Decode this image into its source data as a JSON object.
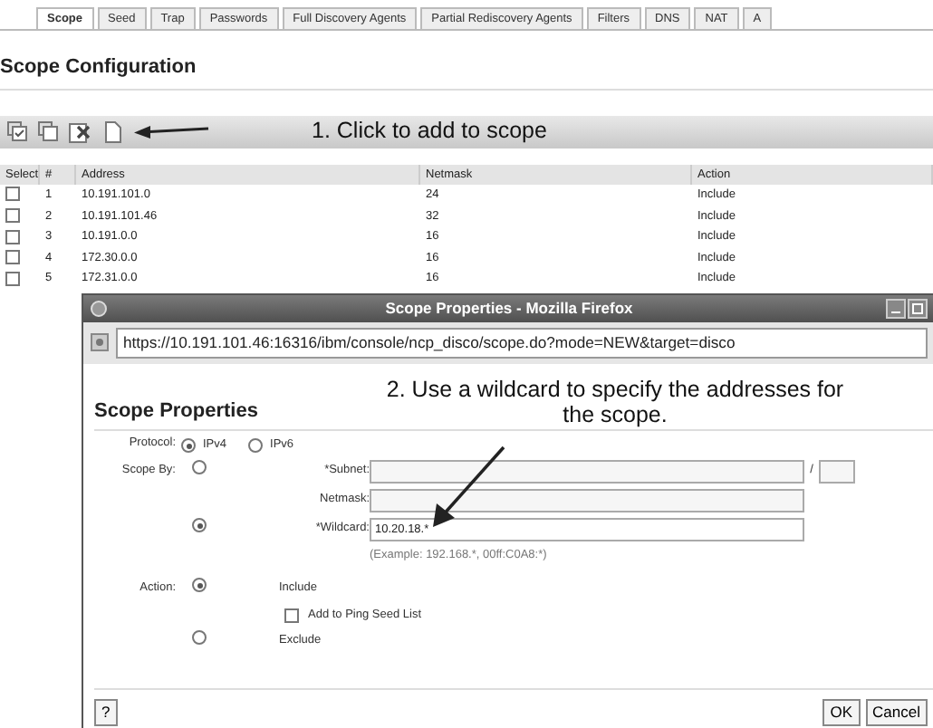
{
  "tabs": [
    {
      "label": "Scope",
      "selected": true
    },
    {
      "label": "Seed",
      "selected": false
    },
    {
      "label": "Trap",
      "selected": false
    },
    {
      "label": "Passwords",
      "selected": false
    },
    {
      "label": "Full Discovery Agents",
      "selected": false
    },
    {
      "label": "Partial Rediscovery Agents",
      "selected": false
    },
    {
      "label": "Filters",
      "selected": false
    },
    {
      "label": "DNS",
      "selected": false
    },
    {
      "label": "NAT",
      "selected": false
    },
    {
      "label": "A",
      "selected": false
    }
  ],
  "heading": "Scope Configuration",
  "toolbar": {
    "annotation": "1. Click to add to scope"
  },
  "table": {
    "columns": [
      "Select",
      "#",
      "Address",
      "Netmask",
      "Action"
    ],
    "rows": [
      {
        "checked": false,
        "number": "1",
        "address": "10.191.101.0",
        "netmask": "24",
        "action": "Include"
      },
      {
        "checked": false,
        "number": "2",
        "address": "10.191.101.46",
        "netmask": "32",
        "action": "Include"
      },
      {
        "checked": false,
        "number": "3",
        "address": "10.191.0.0",
        "netmask": "16",
        "action": "Include"
      },
      {
        "checked": false,
        "number": "4",
        "address": "172.30.0.0",
        "netmask": "16",
        "action": "Include"
      },
      {
        "checked": false,
        "number": "5",
        "address": "172.31.0.0",
        "netmask": "16",
        "action": "Include"
      }
    ]
  },
  "dialog": {
    "title": "Scope Properties - Mozilla Firefox",
    "url": "https://10.191.101.46:16316/ibm/console/ncp_disco/scope.do?mode=NEW&target=disco",
    "heading": "Scope Properties",
    "annotation": "2. Use a wildcard to specify the addresses for the scope.",
    "protocol": {
      "label": "Protocol:",
      "options": [
        {
          "label": "IPv4",
          "selected": true
        },
        {
          "label": "IPv6",
          "selected": false
        }
      ]
    },
    "scope_by": {
      "label": "Scope By:",
      "subnet": {
        "selected": false,
        "label": "*Subnet:",
        "separator": "/",
        "netmask_label": "Netmask:"
      },
      "wildcard": {
        "selected": true,
        "label": "*Wildcard:",
        "value": "10.20.18.*",
        "example": "(Example: 192.168.*, 00ff:C0A8:*)"
      }
    },
    "action": {
      "label": "Action:",
      "options": [
        {
          "label": "Include",
          "selected": true
        },
        {
          "label": "Exclude",
          "selected": false
        }
      ],
      "ping_seed": {
        "label": "Add to Ping Seed List",
        "checked": false
      }
    },
    "buttons": {
      "help": "?",
      "ok": "OK",
      "cancel": "Cancel"
    }
  }
}
